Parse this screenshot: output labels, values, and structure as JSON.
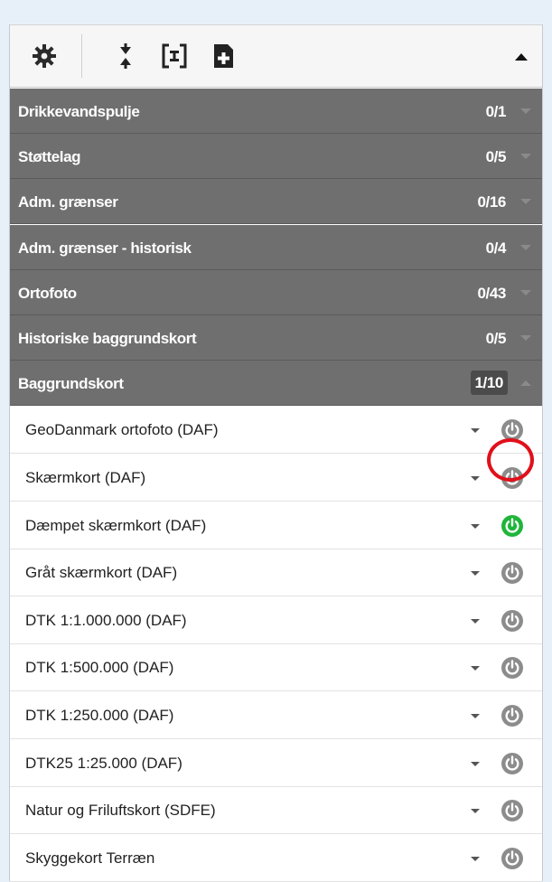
{
  "toolbar": {
    "icons": [
      "settings-gear-icon",
      "expand-collapse-arrows-icon",
      "collapse-all-icon",
      "add-layer-icon"
    ],
    "collapse_icon": "caret-up-icon"
  },
  "groups": [
    {
      "label": "Drikkevandspulje",
      "count": "0/1",
      "expanded": false
    },
    {
      "label": "Støttelag",
      "count": "0/5",
      "expanded": false
    },
    {
      "label": "Adm. grænser",
      "count": "0/16",
      "expanded": false
    },
    {
      "label": "Adm. grænser - historisk",
      "count": "0/4",
      "expanded": false
    },
    {
      "label": "Ortofoto",
      "count": "0/43",
      "expanded": false
    },
    {
      "label": "Historiske baggrundskort",
      "count": "0/5",
      "expanded": false
    },
    {
      "label": "Baggrundskort",
      "count": "1/10",
      "expanded": true
    }
  ],
  "layers": [
    {
      "label": "GeoDanmark ortofoto (DAF)",
      "active": false,
      "highlighted": true
    },
    {
      "label": "Skærmkort (DAF)",
      "active": false
    },
    {
      "label": "Dæmpet skærmkort (DAF)",
      "active": true
    },
    {
      "label": "Gråt skærmkort (DAF)",
      "active": false
    },
    {
      "label": "DTK 1:1.000.000 (DAF)",
      "active": false
    },
    {
      "label": "DTK 1:500.000 (DAF)",
      "active": false
    },
    {
      "label": "DTK 1:250.000 (DAF)",
      "active": false
    },
    {
      "label": "DTK25 1:25.000 (DAF)",
      "active": false
    },
    {
      "label": "Natur og Friluftskort (SDFE)",
      "active": false
    },
    {
      "label": "Skyggekort Terræn",
      "active": false
    }
  ],
  "colors": {
    "power_active": "#1fb53a",
    "power_inactive": "#8c8c8c",
    "group_bg": "#6f6f6f",
    "highlight": "#e0101b"
  }
}
